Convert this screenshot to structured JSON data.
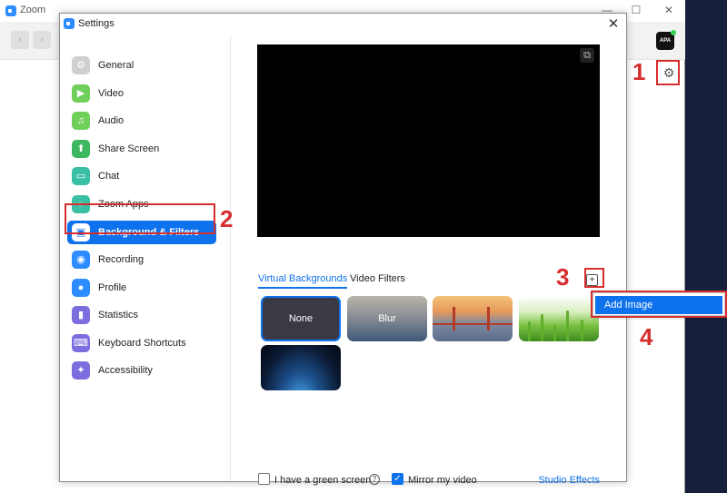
{
  "main_window": {
    "title": "Zoom",
    "minimize": "—",
    "maximize": "☐",
    "close": "✕",
    "back": "‹",
    "forward": "›",
    "avatar_text": "APA"
  },
  "dialog": {
    "title": "Settings",
    "close": "✕"
  },
  "sidebar": {
    "items": [
      {
        "label": "General",
        "icon": "gear-icon",
        "color": "#cfcfcf"
      },
      {
        "label": "Video",
        "icon": "video-camera-icon",
        "color": "#6fcf5a"
      },
      {
        "label": "Audio",
        "icon": "headphones-icon",
        "color": "#6fcf5a"
      },
      {
        "label": "Share Screen",
        "icon": "share-screen-icon",
        "color": "#3db760"
      },
      {
        "label": "Chat",
        "icon": "chat-bubble-icon",
        "color": "#3bbfa4"
      },
      {
        "label": "Zoom Apps",
        "icon": "zoom-apps-icon",
        "color": "#3bbfa4"
      },
      {
        "label": "Background & Filters",
        "icon": "portrait-icon",
        "color": "#2d8cff"
      },
      {
        "label": "Recording",
        "icon": "record-icon",
        "color": "#2d8cff"
      },
      {
        "label": "Profile",
        "icon": "person-icon",
        "color": "#2d8cff"
      },
      {
        "label": "Statistics",
        "icon": "bar-chart-icon",
        "color": "#7d6ee0"
      },
      {
        "label": "Keyboard Shortcuts",
        "icon": "keyboard-icon",
        "color": "#7d6ee0"
      },
      {
        "label": "Accessibility",
        "icon": "accessibility-icon",
        "color": "#7d6ee0"
      }
    ],
    "active_index": 6
  },
  "tabs": {
    "virtual_backgrounds": "Virtual Backgrounds",
    "video_filters": "Video Filters"
  },
  "add_button": "+",
  "backgrounds": [
    {
      "label": "None",
      "selected": true
    },
    {
      "label": "Blur",
      "selected": false
    },
    {
      "label": "",
      "image": "golden-gate-bridge"
    },
    {
      "label": "",
      "image": "grass"
    },
    {
      "label": "",
      "image": "earth-from-space"
    }
  ],
  "footer": {
    "green_screen_label": "I have a green screen",
    "green_screen_checked": false,
    "help": "?",
    "mirror_label": "Mirror my video",
    "mirror_checked": true,
    "studio_effects": "Studio Effects"
  },
  "context_menu": {
    "add_image": "Add Image"
  },
  "annotations": {
    "step1": "1",
    "step2": "2",
    "step3": "3",
    "step4": "4",
    "color": "#d62d2d"
  }
}
